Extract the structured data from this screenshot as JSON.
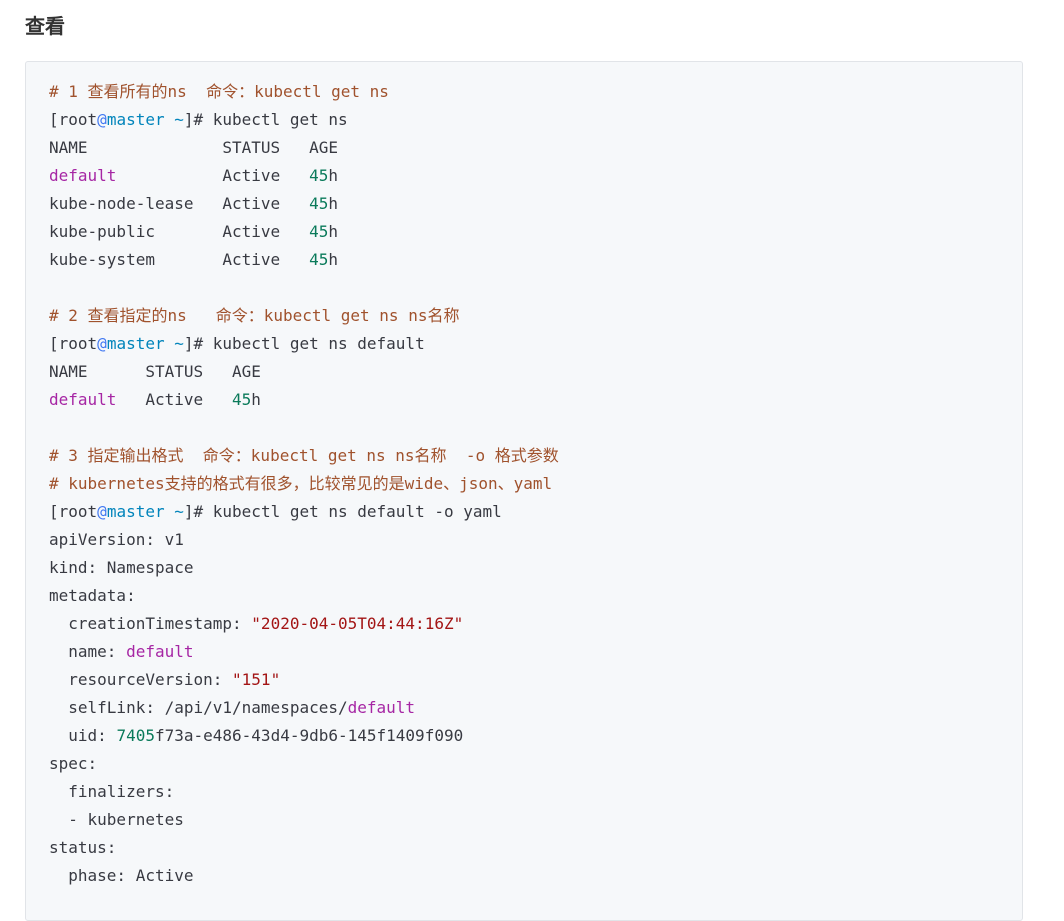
{
  "page": {
    "heading": "查看"
  },
  "code_lines": [
    [
      {
        "t": "# 1 查看所有的ns  命令：kubectl get ns",
        "c": "comment"
      }
    ],
    [
      {
        "t": "[root"
      },
      {
        "t": "@",
        "c": "at"
      },
      {
        "t": "master ~",
        "c": "host"
      },
      {
        "t": "]# kubectl get ns"
      }
    ],
    [
      {
        "t": "NAME              STATUS   AGE"
      }
    ],
    [
      {
        "t": "default",
        "c": "kw"
      },
      {
        "t": "           Active   "
      },
      {
        "t": "45",
        "c": "num"
      },
      {
        "t": "h"
      }
    ],
    [
      {
        "t": "kube-node-lease   Active   "
      },
      {
        "t": "45",
        "c": "num"
      },
      {
        "t": "h"
      }
    ],
    [
      {
        "t": "kube-public       Active   "
      },
      {
        "t": "45",
        "c": "num"
      },
      {
        "t": "h"
      }
    ],
    [
      {
        "t": "kube-system       Active   "
      },
      {
        "t": "45",
        "c": "num"
      },
      {
        "t": "h"
      }
    ],
    [],
    [
      {
        "t": "# 2 查看指定的ns   命令：kubectl get ns ns名称",
        "c": "comment"
      }
    ],
    [
      {
        "t": "[root"
      },
      {
        "t": "@",
        "c": "at"
      },
      {
        "t": "master ~",
        "c": "host"
      },
      {
        "t": "]# kubectl get ns default"
      }
    ],
    [
      {
        "t": "NAME      STATUS   AGE"
      }
    ],
    [
      {
        "t": "default",
        "c": "kw"
      },
      {
        "t": "   Active   "
      },
      {
        "t": "45",
        "c": "num"
      },
      {
        "t": "h"
      }
    ],
    [],
    [
      {
        "t": "# 3 指定输出格式  命令：kubectl get ns ns名称  -o 格式参数",
        "c": "comment"
      }
    ],
    [
      {
        "t": "# kubernetes支持的格式有很多，比较常见的是wide、json、yaml",
        "c": "comment"
      }
    ],
    [
      {
        "t": "[root"
      },
      {
        "t": "@",
        "c": "at"
      },
      {
        "t": "master ~",
        "c": "host"
      },
      {
        "t": "]# kubectl get ns default -o yaml"
      }
    ],
    [
      {
        "t": "apiVersion: v1"
      }
    ],
    [
      {
        "t": "kind: Namespace"
      }
    ],
    [
      {
        "t": "metadata:"
      }
    ],
    [
      {
        "t": "  creationTimestamp: "
      },
      {
        "t": "\"2020-04-05T04:44:16Z\"",
        "c": "str"
      }
    ],
    [
      {
        "t": "  name: "
      },
      {
        "t": "default",
        "c": "kw"
      }
    ],
    [
      {
        "t": "  resourceVersion: "
      },
      {
        "t": "\"151\"",
        "c": "str"
      }
    ],
    [
      {
        "t": "  selfLink: /api/v1/namespaces/"
      },
      {
        "t": "default",
        "c": "path"
      }
    ],
    [
      {
        "t": "  uid: "
      },
      {
        "t": "7405",
        "c": "num"
      },
      {
        "t": "f73a-e486-43d4-9db6-145f1409f090"
      }
    ],
    [
      {
        "t": "spec:"
      }
    ],
    [
      {
        "t": "  finalizers:"
      }
    ],
    [
      {
        "t": "  - kubernetes"
      }
    ],
    [
      {
        "t": "status:"
      }
    ],
    [
      {
        "t": "  phase: Active"
      }
    ]
  ]
}
